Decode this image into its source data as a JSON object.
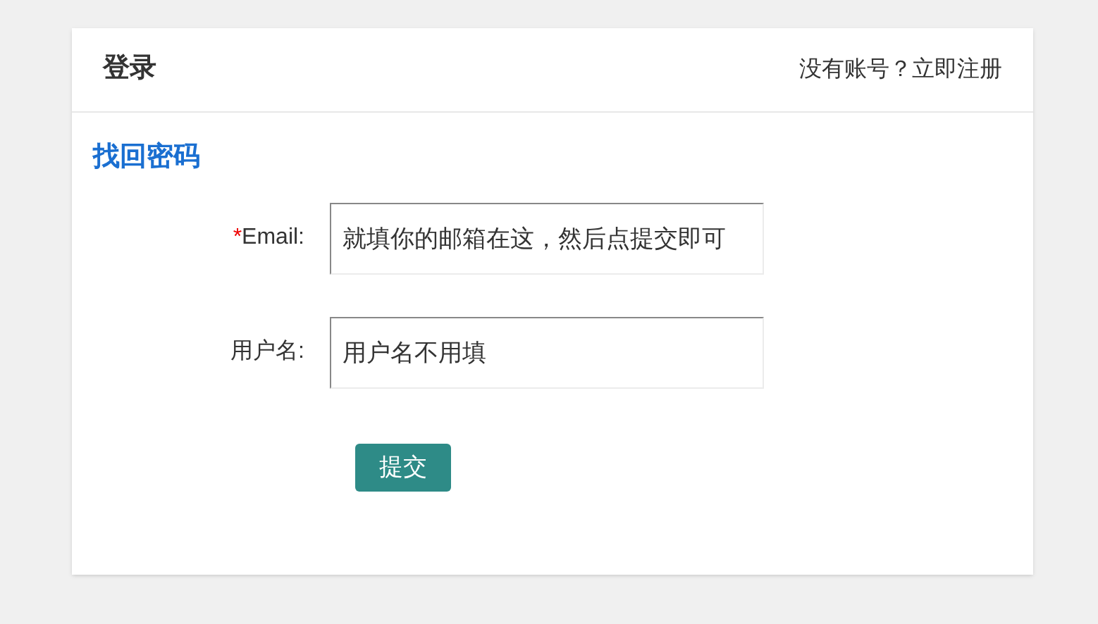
{
  "header": {
    "title": "登录",
    "register_link": "没有账号？立即注册"
  },
  "section_title": "找回密码",
  "fields": [
    {
      "label": "Email:",
      "required_mark": "*",
      "value": "就填你的邮箱在这，然后点提交即可"
    },
    {
      "label": "用户名:",
      "value": "用户名不用填"
    }
  ],
  "submit_button": "提交"
}
